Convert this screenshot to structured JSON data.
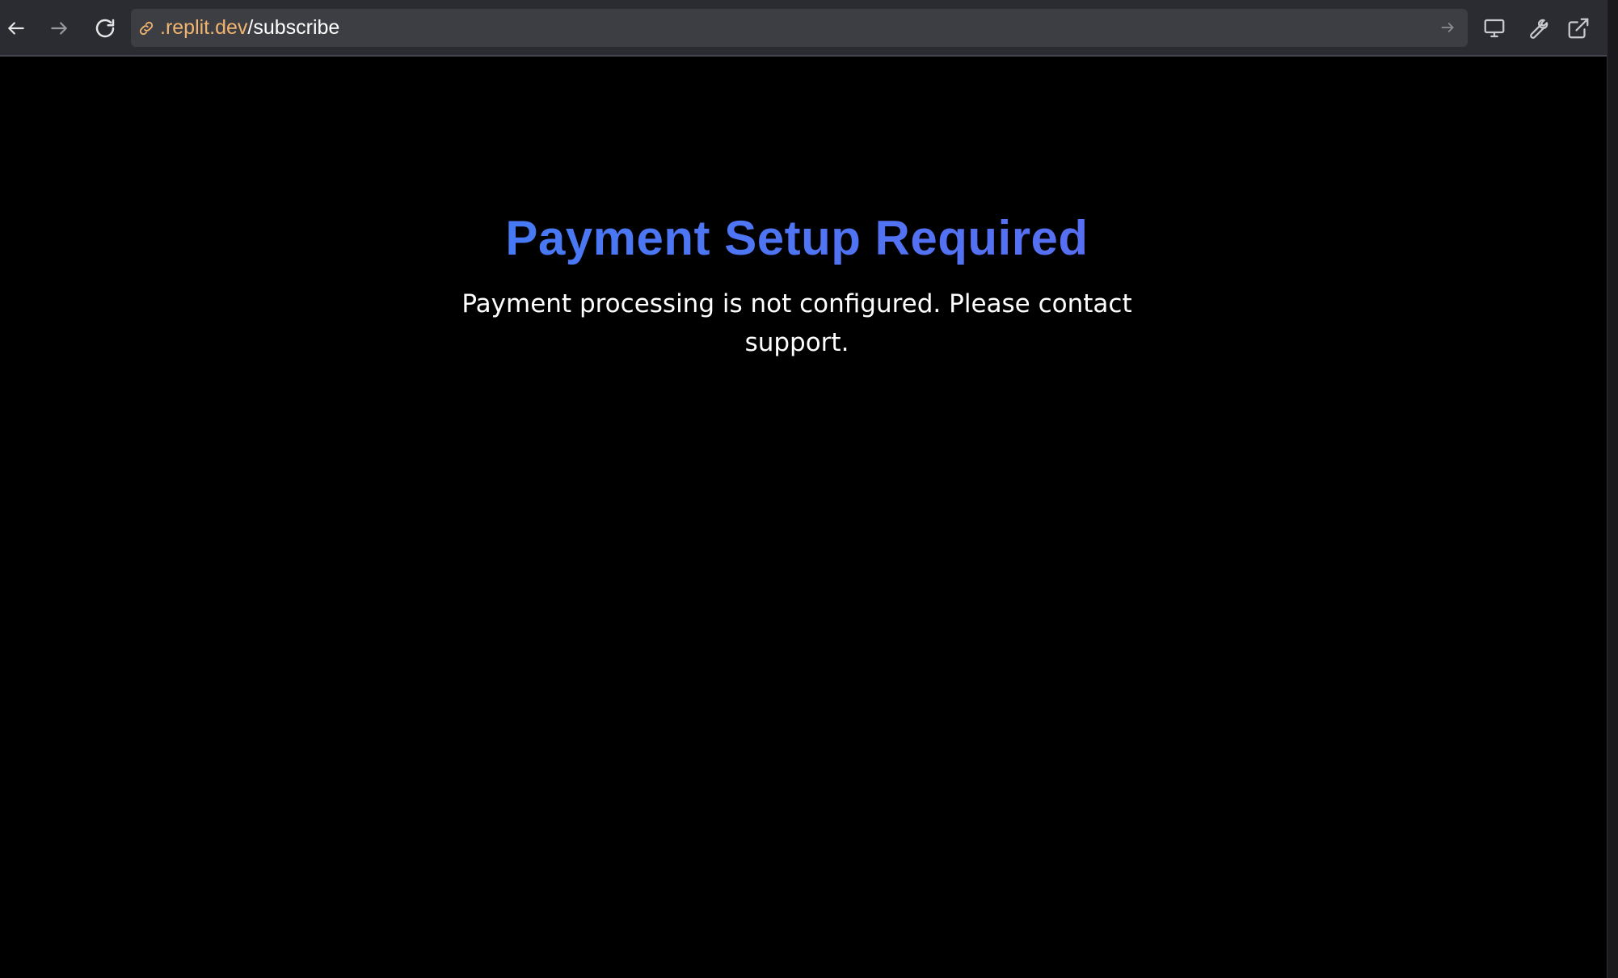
{
  "browser": {
    "url_domain": ".replit.dev",
    "url_path": "/subscribe",
    "icons": {
      "back": "arrow-left-icon",
      "forward": "arrow-right-icon",
      "reload": "reload-icon",
      "link": "link-icon",
      "go": "arrow-right-icon",
      "device": "monitor-icon",
      "devtools": "wrench-icon",
      "open_external": "external-link-icon"
    }
  },
  "page": {
    "title": "Payment Setup Required",
    "message": "Payment processing is not configured. Please contact support."
  },
  "colors": {
    "background": "#000000",
    "toolbar": "#2b2c31",
    "url_bar": "#3d3e44",
    "url_domain": "#f0b46e",
    "title_gradient_start": "#3b82f6",
    "title_gradient_end": "#6366f1",
    "text": "#ffffff"
  }
}
